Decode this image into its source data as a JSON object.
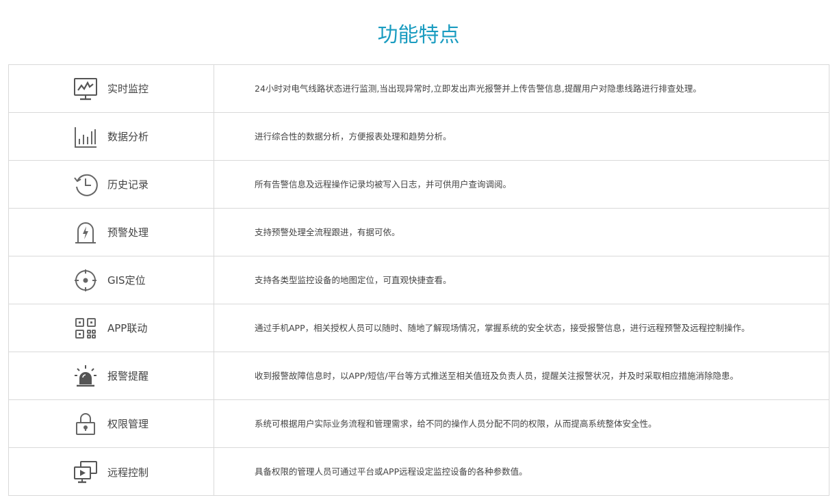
{
  "page": {
    "title": "功能特点",
    "accent_color": "#1a9cc0"
  },
  "features": [
    {
      "icon": "monitor-chart-icon",
      "name": "实时监控",
      "desc": "24小时对电气线路状态进行监测,当出现异常时,立即发出声光报警并上传告警信息,提醒用户对隐患线路进行排查处理。"
    },
    {
      "icon": "bar-chart-icon",
      "name": "数据分析",
      "desc": "进行综合性的数据分析，方便报表处理和趋势分析。"
    },
    {
      "icon": "history-clock-icon",
      "name": "历史记录",
      "desc": "所有告警信息及远程操作记录均被写入日志，并可供用户查询调阅。"
    },
    {
      "icon": "warning-lightning-icon",
      "name": "预警处理",
      "desc": "支持预警处理全流程跟进，有据可依。"
    },
    {
      "icon": "crosshair-locate-icon",
      "name": "GIS定位",
      "desc": "支持各类型监控设备的地图定位，可直观快捷查看。"
    },
    {
      "icon": "qr-code-icon",
      "name": "APP联动",
      "desc": "通过手机APP，相关授权人员可以随时、随地了解现场情况，掌握系统的安全状态，接受报警信息，进行远程预警及远程控制操作。"
    },
    {
      "icon": "alarm-siren-icon",
      "name": "报警提醒",
      "desc": "收到报警故障信息时，以APP/短信/平台等方式推送至相关值班及负责人员，提醒关注报警状况，并及时采取相应措施消除隐患。"
    },
    {
      "icon": "padlock-icon",
      "name": "权限管理",
      "desc": "系统可根据用户实际业务流程和管理需求，给不同的操作人员分配不同的权限，从而提高系统整体安全性。"
    },
    {
      "icon": "remote-screen-icon",
      "name": "远程控制",
      "desc": "具备权限的管理人员可通过平台或APP远程设定监控设备的各种参数值。"
    }
  ]
}
